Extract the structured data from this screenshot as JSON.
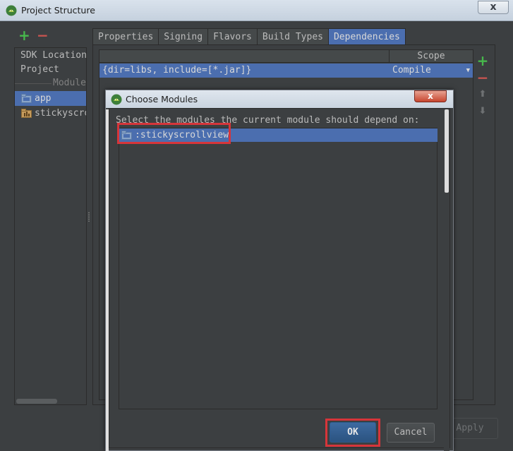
{
  "window": {
    "title": "Project Structure",
    "close_glyph": "x"
  },
  "sidebar": {
    "add_glyph": "+",
    "remove_glyph": "−",
    "items": [
      {
        "label": "SDK Location"
      },
      {
        "label": "Project"
      }
    ],
    "section_label": "Modules",
    "modules": [
      {
        "label": "app",
        "selected": true
      },
      {
        "label": "stickyscrollview",
        "selected": false
      }
    ]
  },
  "tabs": [
    {
      "label": "Properties"
    },
    {
      "label": "Signing"
    },
    {
      "label": "Flavors"
    },
    {
      "label": "Build Types"
    },
    {
      "label": "Dependencies",
      "active": true
    }
  ],
  "dependencies": {
    "scope_header": "Scope",
    "rows": [
      {
        "dependency": "{dir=libs, include=[*.jar]}",
        "scope": "Compile"
      }
    ],
    "add_glyph": "+",
    "remove_glyph": "−",
    "up_glyph": "⬆",
    "down_glyph": "⬇"
  },
  "apply_label": "Apply",
  "dialog": {
    "title": "Choose Modules",
    "close_glyph": "x",
    "prompt": "Select the modules the current module should depend on:",
    "modules": [
      {
        "label": ":stickyscrollview"
      }
    ],
    "ok_label": "OK",
    "cancel_label": "Cancel"
  },
  "colors": {
    "background": "#3c3f41",
    "selection": "#4b6eaf",
    "annotation_red": "#d6353a",
    "add_green": "#47b84c",
    "remove_red": "#c75450"
  },
  "icons": {
    "app": "android-icon",
    "module": "folder-module-icon"
  }
}
